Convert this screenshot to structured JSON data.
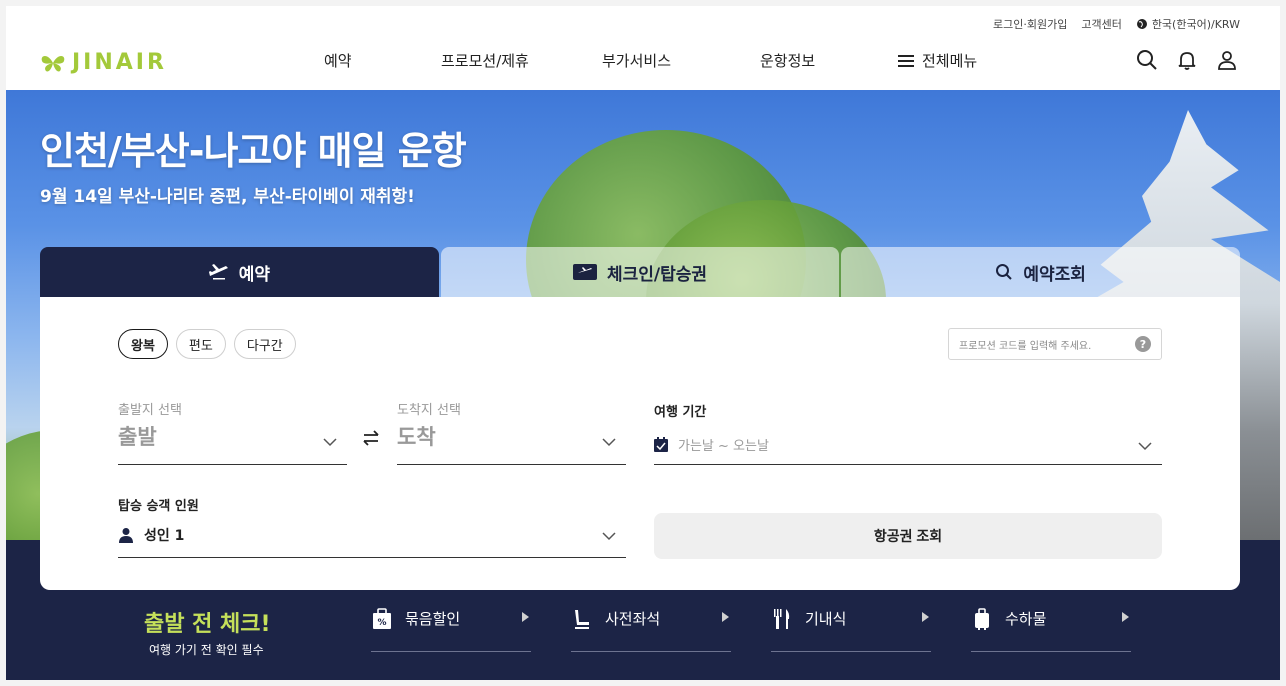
{
  "util": {
    "login": "로그인·회원가입",
    "support": "고객센터",
    "language": "한국(한국어)/KRW"
  },
  "brand": {
    "logo_text": "JINAIR",
    "accent": "#a3c93a"
  },
  "nav": {
    "items": [
      "예약",
      "프로모션/제휴",
      "부가서비스",
      "운항정보"
    ],
    "all_menu": "전체메뉴"
  },
  "header_icons": [
    "search-icon",
    "bell-icon",
    "user-icon"
  ],
  "hero": {
    "title": "인천/부산-나고야 매일 운항",
    "subtitle": "9월 14일 부산-나리타 증편, 부산-타이베이 재취항!"
  },
  "tabs": [
    {
      "label": "예약",
      "icon": "plane-icon",
      "active": true
    },
    {
      "label": "체크인/탑승권",
      "icon": "ticket-icon",
      "active": false
    },
    {
      "label": "예약조회",
      "icon": "search-icon",
      "active": false
    }
  ],
  "booking": {
    "trip_types": [
      "왕복",
      "편도",
      "다구간"
    ],
    "selected_trip_type": "왕복",
    "promo_placeholder": "프로모션 코드를 입력해 주세요.",
    "origin": {
      "label": "출발지 선택",
      "value": "출발"
    },
    "destination": {
      "label": "도착지 선택",
      "value": "도착"
    },
    "period": {
      "label": "여행 기간",
      "value": "가는날 ~ 오는날"
    },
    "passengers": {
      "label": "탑승 승객 인원",
      "value": "성인 1"
    },
    "search_button": "항공권 조회"
  },
  "precheck": {
    "title": "출발 전 체크!",
    "subtitle": "여행 가기 전 확인 필수",
    "items": [
      {
        "label": "묶음할인",
        "icon": "discount-bag-icon"
      },
      {
        "label": "사전좌석",
        "icon": "seat-icon"
      },
      {
        "label": "기내식",
        "icon": "meal-icon"
      },
      {
        "label": "수하물",
        "icon": "luggage-icon"
      }
    ]
  },
  "colors": {
    "navy": "#1c2446",
    "accent": "#c5e05a"
  }
}
